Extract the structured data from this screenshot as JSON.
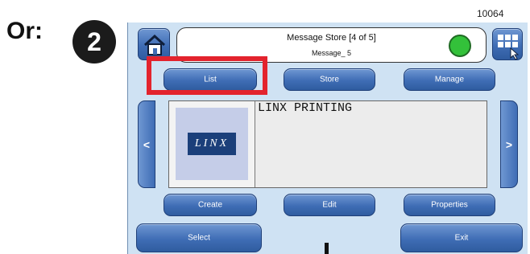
{
  "annotation": {
    "or_label": "Or:",
    "step_number": "2",
    "figure_id": "10064"
  },
  "header": {
    "title": "Message Store [4 of 5]",
    "message_name": "Message_ 5",
    "status_color": "#33c13a",
    "home_icon": "home-icon",
    "menu_icon": "grid-menu-icon"
  },
  "tabs": {
    "list": "List",
    "store": "Store",
    "manage": "Manage"
  },
  "navigation": {
    "prev": "<",
    "next": ">"
  },
  "preview": {
    "logo_text": "LINX",
    "message_text": "LINX PRINTING"
  },
  "actions": {
    "create": "Create",
    "edit": "Edit",
    "properties": "Properties"
  },
  "footer": {
    "select": "Select",
    "exit": "Exit"
  },
  "colors": {
    "highlight": "#e3232d",
    "button": "#3f6db5",
    "screen_bg": "#cfe2f3"
  }
}
